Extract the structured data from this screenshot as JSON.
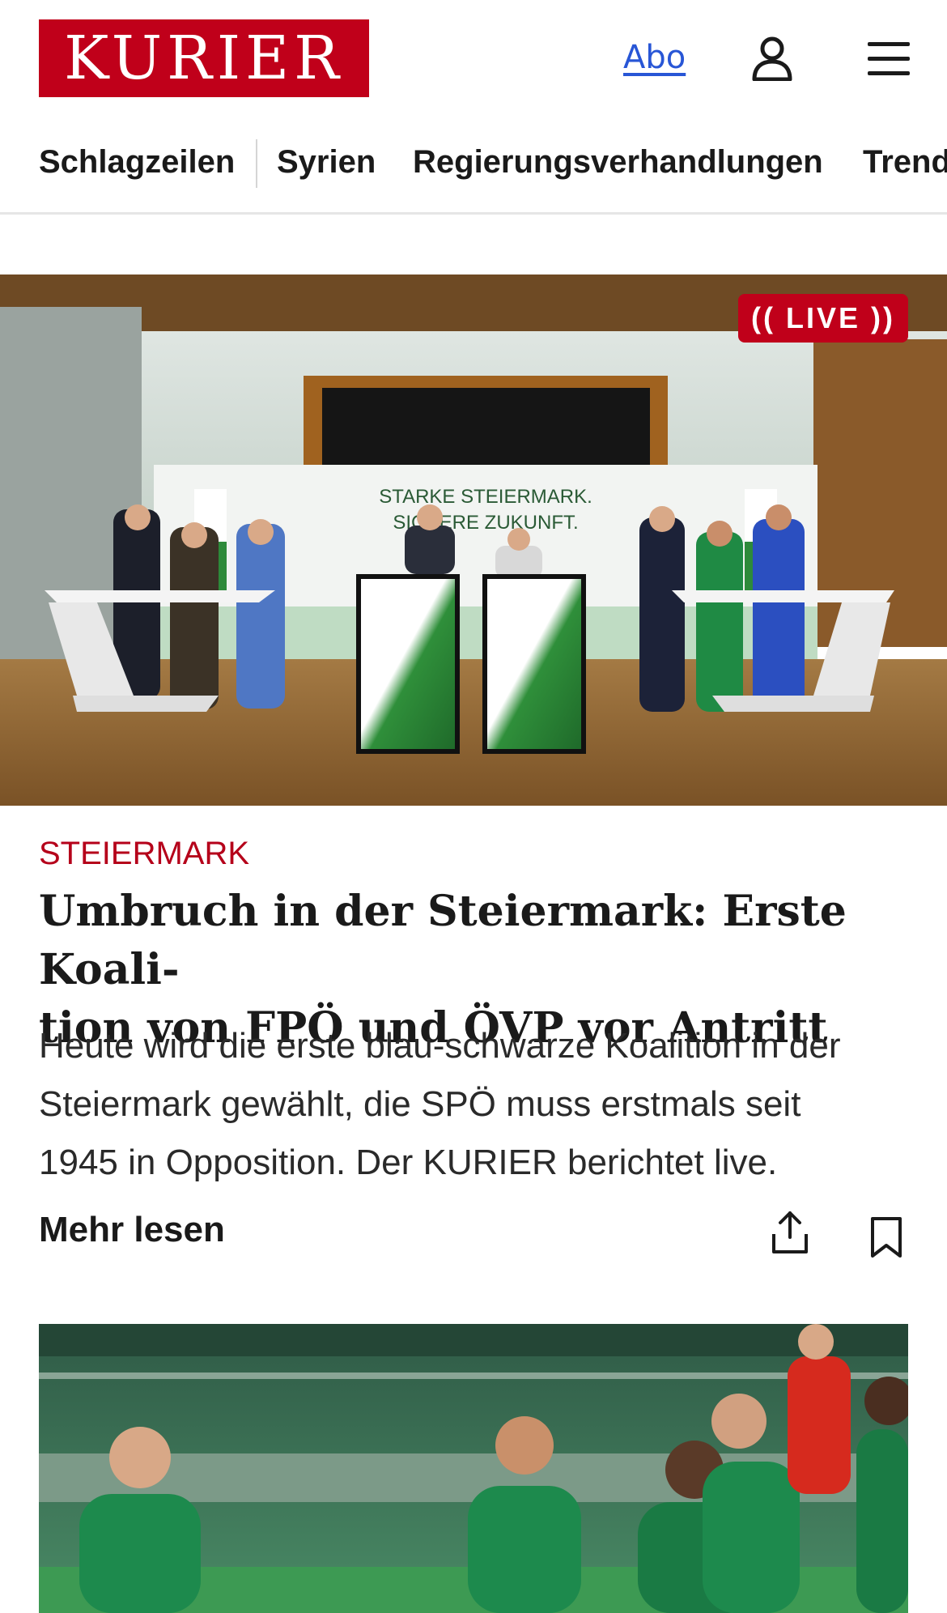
{
  "header": {
    "logo_text": "KURIER",
    "abo_label": "Abo",
    "brand_color": "#c0001a",
    "icons": [
      "user-icon",
      "hamburger-menu-icon"
    ]
  },
  "nav": {
    "items": [
      {
        "label": "Schlagzeilen"
      },
      {
        "label": "Syrien"
      },
      {
        "label": "Regierungsverhandlungen"
      },
      {
        "label": "Trend"
      }
    ]
  },
  "hero": {
    "live_label": "LIVE",
    "backdrop_line1": "STARKE STEIERMARK.",
    "backdrop_line2": "SICHERE ZUKUNFT."
  },
  "article": {
    "kicker": "STEIERMARK",
    "headline_line1": "Umbruch in der Steiermark: Erste Koali-",
    "headline_line2": "tion von FPÖ und ÖVP vor Antritt",
    "teaser_line1": "Heute wird die erste blau-schwarze Koalition in der",
    "teaser_line2": "Steiermark gewählt, die SPÖ muss erstmals seit",
    "teaser_line3": "1945 in Opposition. Der KURIER berichtet live.",
    "more_label": "Mehr lesen",
    "icons": [
      "share-icon",
      "bookmark-icon"
    ]
  }
}
